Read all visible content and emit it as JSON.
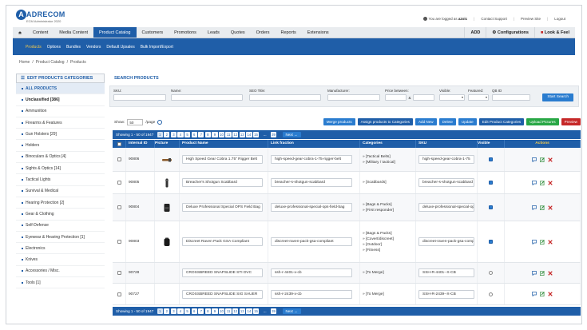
{
  "app": {
    "logo_letter": "A",
    "logo_name": "ADRECOM",
    "logo_sub": "ECM Administrator 2020"
  },
  "topbar": {
    "logged_prefix": "You are logged as",
    "user": "azoic",
    "links": [
      "Contact Support",
      "Preview Site",
      "Logout"
    ]
  },
  "nav": {
    "items": [
      "Content",
      "Media Content",
      "Product Catalog",
      "Customers",
      "Promotions",
      "Leads",
      "Quotes",
      "Orders",
      "Reports",
      "Extensions"
    ],
    "active": "Product Catalog",
    "right": [
      "ADD",
      "Configurations",
      "Look & Feel"
    ]
  },
  "subnav": {
    "items": [
      "Products",
      "Options",
      "Bundles",
      "Vendors",
      "Default Upsales",
      "Bulk Import/Export"
    ],
    "active": "Products"
  },
  "breadcrumb": [
    "Home",
    "/",
    "Product Catalog",
    "/",
    "Products"
  ],
  "sidebar": {
    "title": "EDIT PRODUCTS CATEGORIES",
    "items": [
      "ALL PRODUCTS",
      "Unclassified [386]",
      "Ammunition",
      "Firearms & Features",
      "Gun Holsters [29]",
      "Holders",
      "Binoculars & Optics [4]",
      "Sights & Optics [14]",
      "Tactical Lights",
      "Survival & Medical",
      "Hearing Protection [2]",
      "Gear & Clothing",
      "Self-Defense",
      "Eyewear & Hearing Protection [1]",
      "Electronics",
      "Knives",
      "Accessories / Misc.",
      "Tools [1]"
    ]
  },
  "search": {
    "title": "SEARCH PRODUCTS",
    "fields": {
      "sku": "SKU:",
      "name": "Name:",
      "seo": "SEO Title:",
      "manufacturer": "Manufacturer:",
      "price": "Price between:",
      "price_and": "&",
      "visible": "Visible:",
      "featured": "Featured:",
      "qb": "QB ID"
    },
    "button": "Start Search"
  },
  "toolbar": {
    "show_label": "Show:",
    "page_size": "50",
    "per_page": "/page",
    "buttons": [
      {
        "label": "Merge products",
        "color": "#2a7ccf"
      },
      {
        "label": "Assign products to Categories",
        "color": "#1f5ea8"
      },
      {
        "label": "Add New",
        "color": "#2a7ccf"
      },
      {
        "label": "Delete",
        "color": "#2a7ccf"
      },
      {
        "label": "Update",
        "color": "#2a7ccf"
      },
      {
        "label": "Edit Product Categories",
        "color": "#1f5ea8"
      },
      {
        "label": "Upload Pictures",
        "color": "#28a745"
      },
      {
        "label": "Preview",
        "color": "#c62828"
      }
    ]
  },
  "pagination": {
    "count": "Showing 1 - 50 of 1947",
    "pages": [
      "1",
      "2",
      "3",
      "4",
      "5",
      "6",
      "7",
      "8",
      "9",
      "10",
      "11",
      "12",
      "13",
      "14",
      "15"
    ],
    "ellipsis": "...",
    "last": "39",
    "next": "Next →"
  },
  "table": {
    "headers": [
      "",
      "Internal ID",
      "Picture",
      "Product Name",
      "Link fraction",
      "Categories",
      "SKU",
      "Visible",
      "Actions"
    ],
    "rows": [
      {
        "id": "90806",
        "pic": "holster",
        "name": "High Speed Gear Cobra 1.75\" Rigger Belt",
        "link": "high-speed-gear-cobra-1-75-rigger-belt",
        "cats": [
          "» [Tactical Belts]",
          "» [Military / tactical]"
        ],
        "sku": "high-speed-gear-cobra-1-75",
        "visible": true
      },
      {
        "id": "90805",
        "pic": "scabbard",
        "name": "Breacher's Shotgun Scabbard",
        "link": "breacher-s-shotgun-scabbard",
        "cats": [
          "» [Scabbards]"
        ],
        "sku": "breacher-s-shotgun-scabbard",
        "visible": true
      },
      {
        "id": "90804",
        "pic": "pack",
        "name": "Deluxe Professional Special OPS Field Bag",
        "link": "deluxe-professional-special-ops-field-bag",
        "cats": [
          "» [Bags & Packs]",
          "» [First responder]"
        ],
        "sku": "deluxe-professional-special-ops",
        "visible": true
      },
      {
        "id": "90803",
        "pic": "backpack",
        "name": "Discreet Raven Pack GSA Compliant",
        "link": "discreet-raven-pack-gsa-compliant",
        "cats": [
          "» [Bags & Packs]",
          "» [Covert/discreet]",
          "» [Outdoor]",
          "» [Fitness]"
        ],
        "sku": "discreet-raven-pack-gsa-compliant",
        "visible": true
      },
      {
        "id": "90728",
        "pic": "",
        "name": "CROSSBREED SNAPSLIDE STI DVC",
        "link": "ssh-r-4401-x-cb",
        "cats": [
          "» [To Merge]"
        ],
        "sku": "SSH-R-4401--X-CB",
        "visible": false
      },
      {
        "id": "90727",
        "pic": "",
        "name": "CROSSBREED SNAPSLIDE SIG SAUER",
        "link": "ssh-r-2439-x-cb",
        "cats": [
          "» [To Merge]"
        ],
        "sku": "SSH-R-2439--X-CB",
        "visible": false
      }
    ]
  }
}
